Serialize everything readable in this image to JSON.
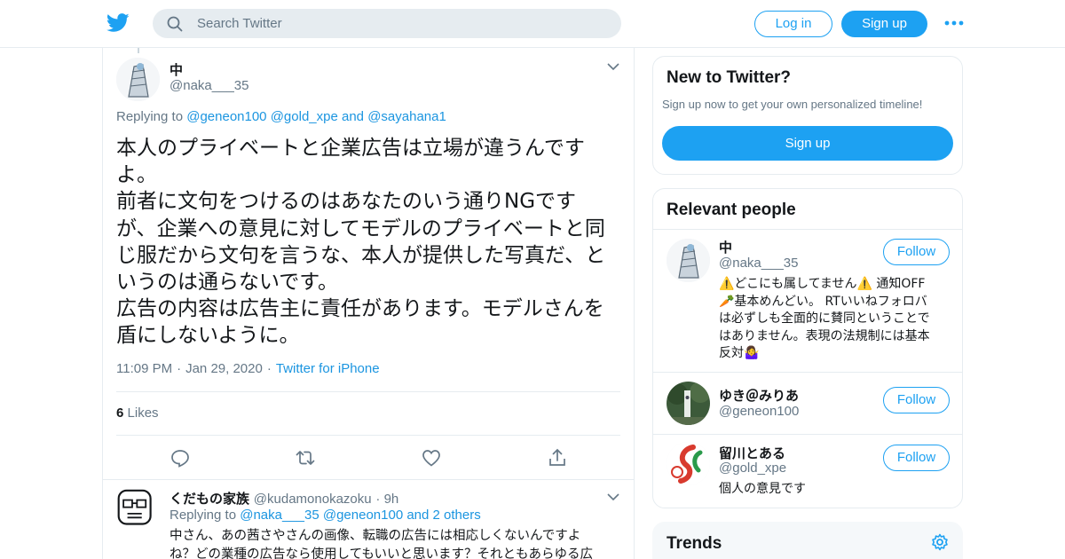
{
  "header": {
    "search_placeholder": "Search Twitter",
    "login_label": "Log in",
    "signup_label": "Sign up"
  },
  "tweet": {
    "author_name": "中",
    "author_handle": "@naka___35",
    "replying_prefix": "Replying to",
    "replying_to": [
      "@geneon100",
      "@gold_xpe",
      "@sayahana1"
    ],
    "replying_and": "and",
    "text_lines": [
      "本人のプライベートと企業広告は立場が違うんです",
      "よ。",
      "前者に文句をつけるのはあなたのいう通りNGです",
      "が、企業への意見に対してモデルのプライベートと同",
      "じ服だから文句を言うな、本人が提供した写真だ、と",
      "いうのは通らないです。",
      "広告の内容は広告主に責任があります。モデルさんを",
      "盾にしないように。"
    ],
    "time": "11:09 PM",
    "date": "Jan 29, 2020",
    "source": "Twitter for iPhone",
    "likes_count": "6",
    "likes_label": "Likes"
  },
  "reply": {
    "author_name": "くだもの家族",
    "author_handle": "@kudamonokazoku",
    "time_ago": "9h",
    "replying_prefix": "Replying to",
    "replying_to": [
      "@naka___35",
      "@geneon100"
    ],
    "replying_others": "and 2 others",
    "text_lines": [
      "中さん、あの茜さやさんの画像、転職の広告には相応しくないんですよ",
      "ね？どの業種の広告なら使用してもいいと思います？それともあらゆる広"
    ]
  },
  "sidebar": {
    "new_title": "New to Twitter?",
    "new_sub": "Sign up now to get your own personalized timeline!",
    "new_signup": "Sign up",
    "people_title": "Relevant people",
    "follow_label": "Follow",
    "people": [
      {
        "name": "中",
        "handle": "@naka___35",
        "bio_lines": [
          "⚠️どこにも属してません⚠️ 通知OFF",
          "🥕基本めんどい。 RTいいねフォロバ",
          "は必ずしも全面的に賛同ということで",
          "はありません。表現の法規制には基本",
          "反対🤷‍♀️"
        ]
      },
      {
        "name": "ゆき＠みりあ",
        "handle": "@geneon100",
        "bio_lines": []
      },
      {
        "name": "留川とある",
        "handle": "@gold_xpe",
        "bio_lines": [
          "個人の意見です"
        ]
      }
    ],
    "trends_title": "Trends"
  },
  "colors": {
    "accent": "#1da1f2",
    "link": "#1b95e0",
    "muted": "#657786",
    "border": "#e6ecf0"
  }
}
